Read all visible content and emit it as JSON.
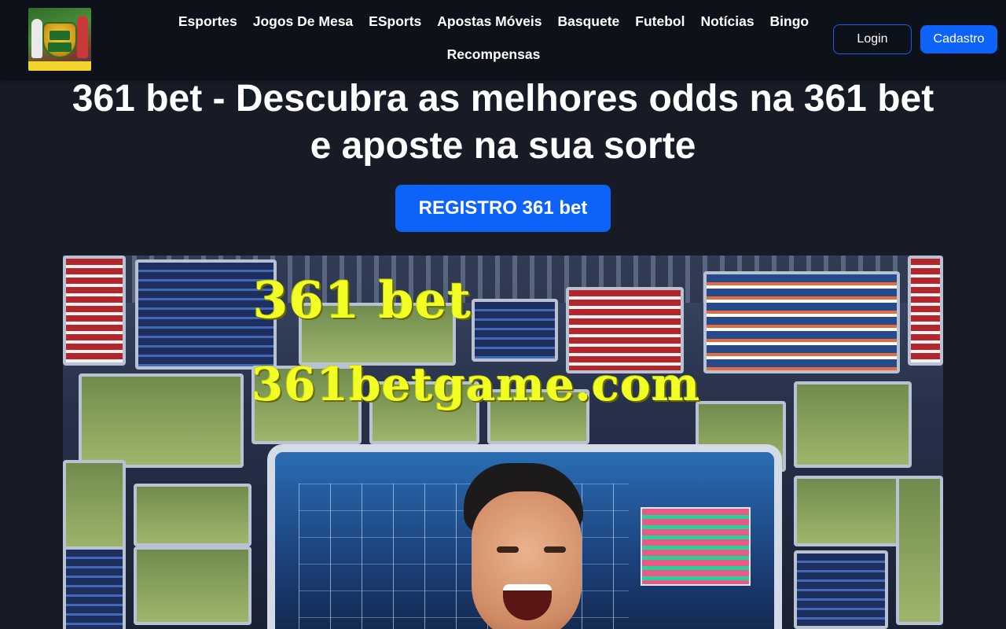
{
  "header": {
    "logo_alt": "361 BET 361betgame.com",
    "nav": [
      {
        "label": "Esportes"
      },
      {
        "label": "Jogos De Mesa"
      },
      {
        "label": "ESports"
      },
      {
        "label": "Apostas Móveis"
      },
      {
        "label": "Basquete"
      },
      {
        "label": "Futebol"
      },
      {
        "label": "Notícias"
      },
      {
        "label": "Bingo"
      },
      {
        "label": "Recompensas"
      }
    ],
    "login_label": "Login",
    "signup_label": "Cadastro"
  },
  "hero": {
    "title": "361 bet - Descubra as melhores odds na 361 bet e aposte na sua sorte",
    "cta_label": "REGISTRO 361 bet"
  },
  "banner": {
    "line1": "361 bet",
    "line2": "361betgame.com"
  },
  "colors": {
    "page_bg": "#161b26",
    "header_bg": "#0d1119",
    "accent_blue": "#0d62f8",
    "banner_text": "#f2ff25"
  }
}
